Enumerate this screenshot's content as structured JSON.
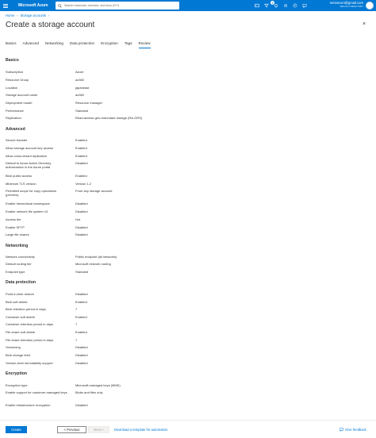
{
  "topbar": {
    "brand": "Microsoft Azure",
    "search_placeholder": "Search resources, services, and docs (G+/)",
    "notification_count": "2",
    "user_email": "mmosconi@gmail.com",
    "user_directory": "DEFAULT DIRECTORY",
    "icons": [
      "menu-icon",
      "search-icon",
      "cloud-shell-icon",
      "filter-icon",
      "bell-icon",
      "gear-icon",
      "help-icon",
      "feedback-icon"
    ]
  },
  "breadcrumb": [
    "Home",
    "Storage accounts"
  ],
  "page": {
    "title": "Create a storage account",
    "more": "...",
    "close": "×"
  },
  "tabs": [
    "Basics",
    "Advanced",
    "Networking",
    "Data protection",
    "Encryption",
    "Tags",
    "Review"
  ],
  "sections": {
    "basics": {
      "title": "Basics",
      "rows": [
        {
          "k": "Subscription",
          "v": "Azure"
        },
        {
          "k": "Resource Group",
          "v": "az360"
        },
        {
          "k": "Location",
          "v": "japaneast"
        },
        {
          "k": "Storage account name",
          "v": "az360"
        },
        {
          "k": "Deployment model",
          "v": "Resource manager"
        },
        {
          "k": "Performance",
          "v": "Standard"
        },
        {
          "k": "Replication",
          "v": "Read-access geo-redundant storage (RA-GRS)"
        }
      ]
    },
    "advanced": {
      "title": "Advanced",
      "rows": [
        {
          "k": "Secure transfer",
          "v": "Enabled"
        },
        {
          "k": "Allow storage account key access",
          "v": "Enabled"
        },
        {
          "k": "Allow cross-tenant replication",
          "v": "Enabled"
        },
        {
          "k": "Default to Azure Active Directory authorization in the Azure portal",
          "v": "Disabled"
        },
        {
          "k": "Blob public access",
          "v": "Enabled"
        },
        {
          "k": "Minimum TLS version",
          "v": "Version 1.2"
        },
        {
          "k": "Permitted scope for copy operations (preview)",
          "v": "From any storage account"
        },
        {
          "k": "Enable hierarchical namespace",
          "v": "Disabled"
        },
        {
          "k": "Enable network file system v3",
          "v": "Disabled"
        },
        {
          "k": "Access tier",
          "v": "Hot"
        },
        {
          "k": "Enable SFTP",
          "v": "Disabled"
        },
        {
          "k": "Large file shares",
          "v": "Disabled"
        }
      ]
    },
    "networking": {
      "title": "Networking",
      "rows": [
        {
          "k": "Network connectivity",
          "v": "Public endpoint (all networks)"
        },
        {
          "k": "Default routing tier",
          "v": "Microsoft network routing"
        },
        {
          "k": "Endpoint type",
          "v": "Standard"
        }
      ]
    },
    "data_protection": {
      "title": "Data protection",
      "rows": [
        {
          "k": "Point-in-time restore",
          "v": "Disabled"
        },
        {
          "k": "Blob soft delete",
          "v": "Enabled"
        },
        {
          "k": "Blob retention period in days",
          "v": "7"
        },
        {
          "k": "Container soft delete",
          "v": "Enabled"
        },
        {
          "k": "Container retention period in days",
          "v": "7"
        },
        {
          "k": "File share soft delete",
          "v": "Enabled"
        },
        {
          "k": "File share retention period in days",
          "v": "7"
        },
        {
          "k": "Versioning",
          "v": "Disabled"
        },
        {
          "k": "Blob change feed",
          "v": "Disabled"
        },
        {
          "k": "Version-level immutability support",
          "v": "Disabled"
        }
      ]
    },
    "encryption": {
      "title": "Encryption",
      "rows": [
        {
          "k": "Encryption type",
          "v": "Microsoft-managed keys (MMK)"
        },
        {
          "k": "Enable support for customer-managed keys",
          "v": "Blobs and files only"
        },
        {
          "k": "Enable infrastructure encryption",
          "v": "Disabled"
        }
      ]
    }
  },
  "footer": {
    "create": "Create",
    "previous": "< Previous",
    "next": "Next >",
    "template_link": "Download a template for automation",
    "feedback": "Give feedback"
  },
  "colors": {
    "accent": "#0078d4",
    "text": "#323130"
  }
}
